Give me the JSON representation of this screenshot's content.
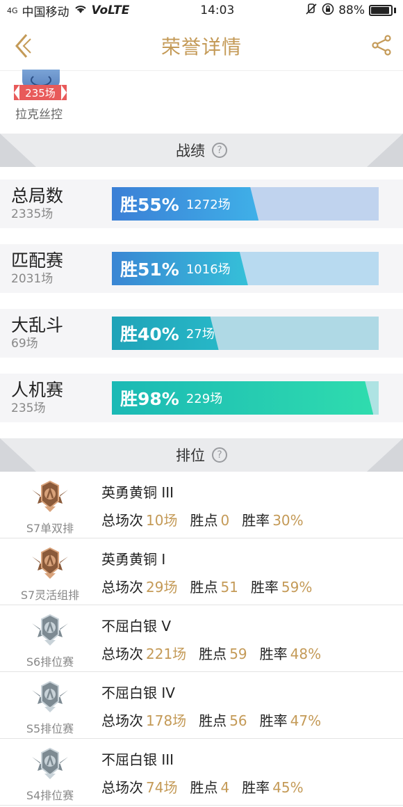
{
  "status": {
    "signal_label": "4G",
    "carrier": "中国移动",
    "volte": "VoLTE",
    "time": "14:03",
    "battery": "88%"
  },
  "nav": {
    "title": "荣誉详情"
  },
  "hero": {
    "badge": "235场",
    "name": "拉克丝控"
  },
  "record_section": {
    "title": "战绩",
    "help": "?"
  },
  "stats": [
    {
      "mode": "总局数",
      "total": "2335场",
      "rate_text": "胜55%",
      "games": "1272场",
      "win_fraction": 0.55,
      "fill": "linear-gradient(90deg,#3b7fd6,#3fb0e8)",
      "track": "#c0d3ee"
    },
    {
      "mode": "匹配赛",
      "total": "2031场",
      "rate_text": "胜51%",
      "games": "1016场",
      "win_fraction": 0.51,
      "fill": "linear-gradient(90deg,#3a86d4,#35c0d8)",
      "track": "#b8daf0"
    },
    {
      "mode": "大乱斗",
      "total": "69场",
      "rate_text": "胜40%",
      "games": "27场",
      "win_fraction": 0.4,
      "fill": "linear-gradient(90deg,#1fa3b8,#27b7c7)",
      "track": "#afd9e5"
    },
    {
      "mode": "人机赛",
      "total": "235场",
      "rate_text": "胜98%",
      "games": "229场",
      "win_fraction": 0.98,
      "fill": "linear-gradient(90deg,#1bb9b5,#2fdcae)",
      "track": "#aee3e3"
    }
  ],
  "rank_section": {
    "title": "排位",
    "help": "?"
  },
  "rank_labels": {
    "total": "总场次",
    "points": "胜点",
    "rate": "胜率"
  },
  "ranks": [
    {
      "tier": "英勇黄铜 III",
      "season": "S7单双排",
      "total": "10场",
      "points": "0",
      "rate": "30%",
      "emblem": "bronze"
    },
    {
      "tier": "英勇黄铜 I",
      "season": "S7灵活组排",
      "total": "29场",
      "points": "51",
      "rate": "59%",
      "emblem": "bronze"
    },
    {
      "tier": "不屈白银 V",
      "season": "S6排位赛",
      "total": "221场",
      "points": "59",
      "rate": "48%",
      "emblem": "silver"
    },
    {
      "tier": "不屈白银 IV",
      "season": "S5排位赛",
      "total": "178场",
      "points": "56",
      "rate": "47%",
      "emblem": "silver"
    },
    {
      "tier": "不屈白银 III",
      "season": "S4排位赛",
      "total": "74场",
      "points": "4",
      "rate": "45%",
      "emblem": "silver"
    }
  ],
  "colors": {
    "accent": "#c49a57",
    "bronze": "#8a5a3a",
    "silver": "#7d8a92"
  }
}
